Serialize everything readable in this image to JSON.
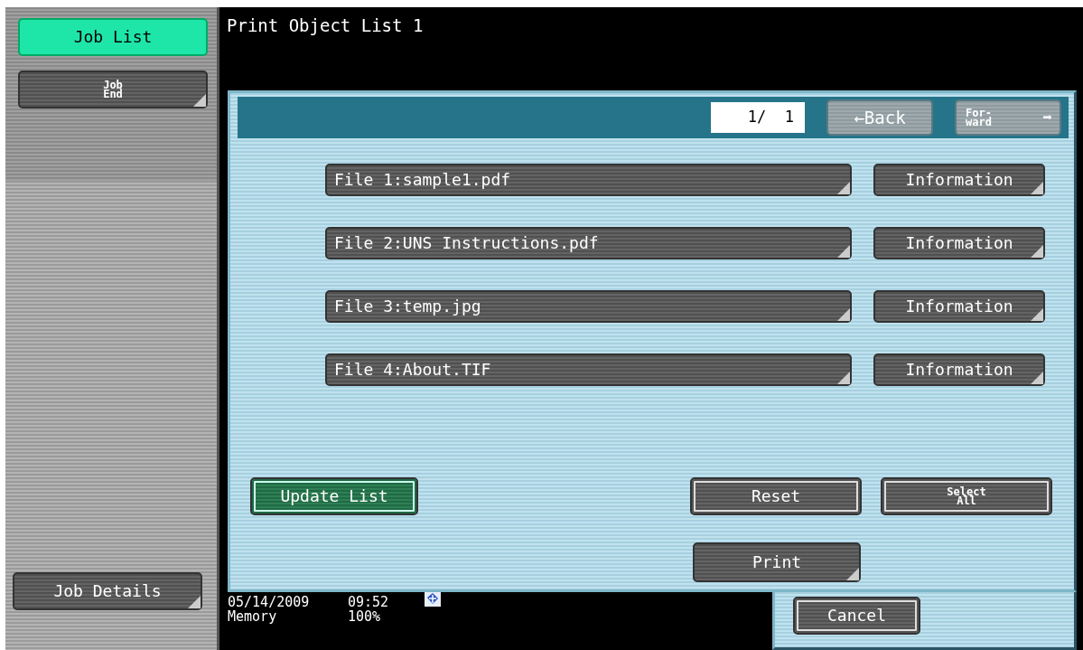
{
  "sidebar": {
    "items": [
      {
        "label_lines": [
          "Job List"
        ],
        "selected": true,
        "kind": "plain"
      },
      {
        "label_lines": [
          "Job",
          "End"
        ],
        "selected": false,
        "kind": "menu"
      }
    ],
    "bottom_items": [
      {
        "label_lines": [
          "Job Details"
        ],
        "selected": false,
        "kind": "menu"
      }
    ]
  },
  "window": {
    "title": "Print Object List 1"
  },
  "pager": {
    "page": "1/  1",
    "back": {
      "arrow": "←",
      "label": "Back"
    },
    "forward": {
      "label_lines": [
        "For-",
        "ward"
      ],
      "arrow": "➡"
    }
  },
  "files": [
    {
      "name": "File 1:sample1.pdf",
      "info_button": "Information"
    },
    {
      "name": "File 2:UNS Instructions.pdf",
      "info_button": "Information"
    },
    {
      "name": "File 3:temp.jpg",
      "info_button": "Information"
    },
    {
      "name": "File 4:About.TIF",
      "info_button": "Information"
    }
  ],
  "actions": [
    {
      "label_lines": [
        "Update List"
      ],
      "kind": "green"
    },
    {
      "label_lines": [
        "Reset"
      ],
      "kind": "action"
    },
    {
      "label_lines": [
        "Select",
        "All"
      ],
      "kind": "action"
    }
  ],
  "print_button": {
    "label_lines": [
      "Print"
    ],
    "kind": "menu"
  },
  "cancel_button": {
    "label_lines": [
      "Cancel"
    ],
    "kind": "action"
  },
  "status_bar": {
    "date": "05/14/2009",
    "time": "09:52",
    "memory_label": "Memory",
    "memory_value": "100%"
  }
}
